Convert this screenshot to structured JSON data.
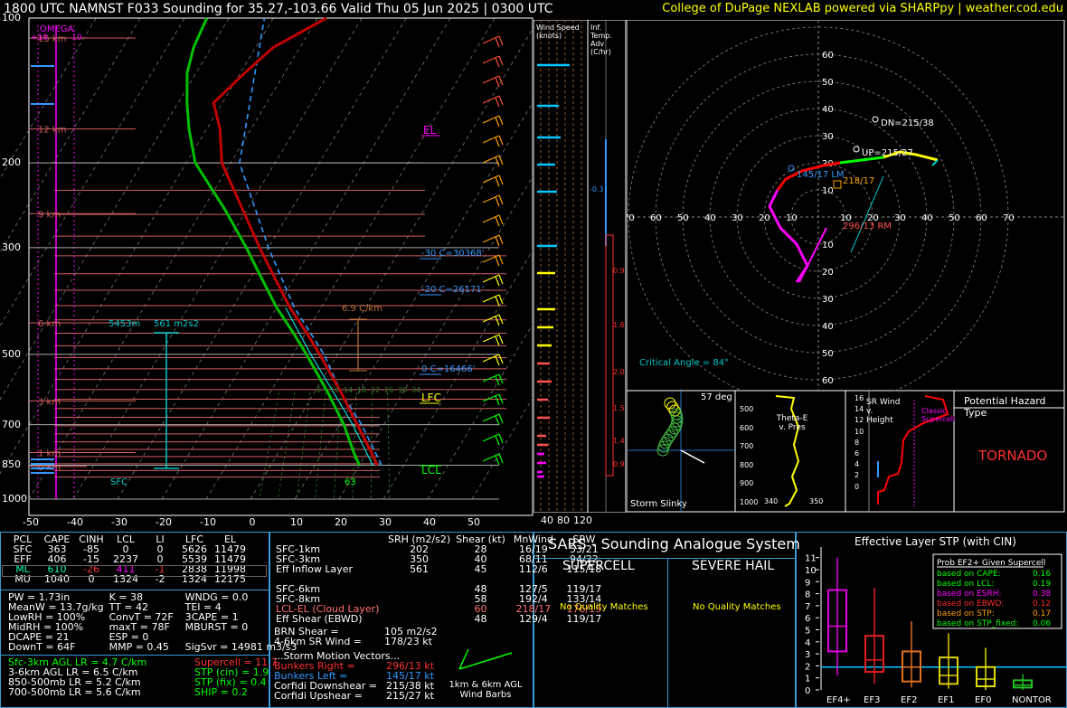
{
  "header": {
    "title": "1800 UTC NAMNST F033 Sounding for 35.27,-103.66 Valid  Thu 05 Jun 2025 | 0300 UTC",
    "credit": "College of DuPage NEXLAB powered via SHARPpy | weather.cod.edu"
  },
  "skewt": {
    "pressure_ticks": [
      "100",
      "200",
      "300",
      "500",
      "700",
      "850",
      "1000"
    ],
    "temp_ticks": [
      "-50",
      "-40",
      "-30",
      "-20",
      "-10",
      "0",
      "10",
      "20",
      "30",
      "40",
      "50"
    ],
    "height_labels": [
      "15 km",
      "12 km",
      "9 km",
      "6 km",
      "3 km",
      "1 km",
      "0 km"
    ],
    "omega_label": "OMEGA",
    "omega_scale": "+10",
    "omega_scale_neg": "-10",
    "el_label": "EL",
    "lfc_label": "LFC",
    "lcl_label": "LCL",
    "sfc_label": "SFC",
    "hgz_labels": [
      "-30 C=30368'",
      "-20 C=26171'",
      "0 C=16466'"
    ],
    "effective_inflow": "5453m",
    "srh_label": "561 m2s2",
    "lapse_label": "6.9 C/km",
    "sfc_temp_label": "63",
    "mixing_ratios": [
      "6",
      "10",
      "14",
      "18",
      "22",
      "26",
      "30",
      "34"
    ],
    "colors": {
      "temp": "#e00000",
      "dew": "#00c000",
      "wetbulb": "#00ffff",
      "virtual": "#3399ff"
    }
  },
  "wind_speed_panel": {
    "title": "Wind Speed (knots)",
    "ticks": [
      "40",
      "80",
      "120"
    ]
  },
  "inferred_adv": {
    "title": "Inf. Temp. Adv (C/hr)",
    "values": [
      "-0.3",
      "0.9",
      "1.6",
      "2.0",
      "1.5",
      "1.4",
      "0.9"
    ]
  },
  "hodograph": {
    "rings": [
      "10",
      "20",
      "30",
      "40",
      "50",
      "60",
      "70"
    ],
    "dn": "DN=215/38",
    "up": "UP=215/27",
    "left_mover": "145/17 LM",
    "mean": "218/17",
    "right_mover": "296/13 RM",
    "critical_angle": "Critical Angle = 84°"
  },
  "storm_slinky": {
    "label": "Storm Slinky",
    "angle": "57 deg"
  },
  "theta_e": {
    "label": "Theta-E v. Pres",
    "y_ticks": [
      "500",
      "600",
      "700",
      "800",
      "900",
      "1000"
    ],
    "x_ticks": [
      "340",
      "350"
    ]
  },
  "sr_wind": {
    "label": "SR Wind v. Height",
    "y_ticks": [
      "16",
      "14",
      "12",
      "10",
      "8",
      "6",
      "4",
      "2",
      "0"
    ],
    "classic": "Classic Supercell"
  },
  "hazard": {
    "title": "Potential Hazard Type",
    "value": "TORNADO"
  },
  "parcels": {
    "headers": [
      "PCL",
      "CAPE",
      "CINH",
      "LCL",
      "LI",
      "LFC",
      "EL"
    ],
    "rows": [
      [
        "SFC",
        "363",
        "-85",
        "0",
        "0",
        "5626",
        "11479"
      ],
      [
        "EFF",
        "406",
        "-15",
        "2237",
        "0",
        "5539",
        "11479"
      ],
      [
        "ML",
        "610",
        "-26",
        "411",
        "-1",
        "2838",
        "11998"
      ],
      [
        "MU",
        "1040",
        "0",
        "1324",
        "-2",
        "1324",
        "12175"
      ]
    ]
  },
  "indices": {
    "col1": [
      "PW = 1.73in",
      "MeanW = 13.7g/kg",
      "LowRH = 100%",
      "MidRH = 100%",
      "DCAPE = 21",
      "DownT = 64F"
    ],
    "col2": [
      "K = 38",
      "TT = 42",
      "ConvT = 72F",
      "maxT = 78F",
      "ESP = 0",
      "MMP = 0.45"
    ],
    "col3": [
      "WNDG = 0.0",
      "TEI = 4",
      "3CAPE = 1",
      "MBURST = 0",
      "",
      "SigSvr = 14981 m3/s3"
    ]
  },
  "lapse": {
    "left": [
      "Sfc-3km AGL LR = 4.7 C/km",
      "3-6km AGL LR = 6.5 C/km",
      "850-500mb LR = 5.2 C/km",
      "700-500mb LR = 5.6 C/km"
    ],
    "right": [
      "Supercell = 11.7",
      "STP (cin) = 1.9",
      "STP (fix) = 0.4",
      "SHIP = 0.2"
    ]
  },
  "kinematics": {
    "headers": [
      "SRH (m2/s2)",
      "Shear (kt)",
      "MnWind",
      "SRW"
    ],
    "rows": [
      [
        "SFC-1km",
        "202",
        "28",
        "16/19",
        "53/21"
      ],
      [
        "SFC-3km",
        "350",
        "40",
        "68/11",
        "94/22"
      ],
      [
        "Eff Inflow Layer",
        "561",
        "45",
        "112/6",
        "115/18"
      ],
      [
        "",
        "",
        "",
        "",
        ""
      ],
      [
        "SFC-6km",
        "",
        "48",
        "127/5",
        "119/17"
      ],
      [
        "SFC-8km",
        "",
        "58",
        "192/4",
        "133/14"
      ],
      [
        "LCL-EL (Cloud Layer)",
        "",
        "60",
        "218/17",
        "176/19"
      ],
      [
        "Eff Shear (EBWD)",
        "",
        "48",
        "129/4",
        "119/17"
      ]
    ],
    "brn": "BRN Shear =",
    "brn_val": "105 m2/s2",
    "sr46": "4-6km SR Wind =",
    "sr46_val": "178/23 kt",
    "sm_title": "...Storm Motion Vectors...",
    "sm": [
      [
        "Bunkers Right =",
        "296/13 kt"
      ],
      [
        "Bunkers Left =",
        "145/17 kt"
      ],
      [
        "Corfidi Downshear =",
        "215/38 kt"
      ],
      [
        "Corfidi Upshear =",
        "215/27 kt"
      ]
    ],
    "barbs_label": "1km & 6km AGL Wind Barbs"
  },
  "sars": {
    "title": "SARS - Sounding Analogue System",
    "supercell": "SUPERCELL",
    "hail": "SEVERE HAIL",
    "sc_match": "No Quality Matches",
    "hail_match": "No Quality Matches"
  },
  "stp": {
    "title": "Effective Layer STP (with CIN)",
    "legend_title": "Prob EF2+ Given Supercell",
    "legend": [
      [
        "based on CAPE:",
        "0.16"
      ],
      [
        "based on LCL:",
        "0.19"
      ],
      [
        "based on ESRH:",
        "0.38"
      ],
      [
        "based on EBWD:",
        "0.12"
      ],
      [
        "based on STP:",
        "0.17"
      ],
      [
        "based on STP_fixed:",
        "0.06"
      ]
    ],
    "y_ticks": [
      "0",
      "1",
      "2",
      "3",
      "4",
      "5",
      "6",
      "7",
      "8",
      "9",
      "10",
      "11"
    ],
    "categories": [
      "EF4+",
      "EF3",
      "EF2",
      "EF1",
      "EF0",
      "NONTOR"
    ],
    "current": 1.9
  },
  "chart_data": [
    {
      "type": "line",
      "title": "1800 UTC NAMNST F033 Sounding for 35.27,-103.66 Valid  Thu 05 Jun 2025 | 0300 UTC",
      "xlabel": "",
      "ylabel": "",
      "ylim": [
        1000,
        100
      ],
      "xlim": [
        -50,
        50
      ],
      "series": [
        {
          "name": "",
          "x_units": "C",
          "points": [
            [
              1000,
              null
            ],
            [
              850,
              24
            ],
            [
              800,
              20
            ],
            [
              700,
              13
            ],
            [
              600,
              5
            ],
            [
              500,
              -5
            ],
            [
              400,
              -17
            ],
            [
              300,
              -32
            ],
            [
              250,
              -40
            ],
            [
              200,
              -50
            ],
            [
              150,
              -58
            ],
            [
              120,
              -62
            ],
            [
              100,
              -58
            ]
          ]
        },
        {
          "name": "",
          "x_units": "C",
          "points": [
            [
              850,
              19
            ],
            [
              800,
              17
            ],
            [
              700,
              12
            ],
            [
              600,
              4
            ],
            [
              500,
              -7
            ],
            [
              400,
              -19
            ],
            [
              300,
              -34
            ],
            [
              250,
              -43
            ],
            [
              200,
              -55
            ],
            [
              150,
              -66
            ],
            [
              100,
              -80
            ]
          ]
        }
      ]
    },
    {
      "type": "bar",
      "title": "Effective Layer STP (with CIN)",
      "categories": [
        "EF4+",
        "EF3",
        "EF2",
        "EF1",
        "EF0",
        "NONTOR"
      ],
      "series": [
        {
          "name": "",
          "values": [
            [
              1.2,
              3.2,
              5.3,
              8.3,
              11.0
            ],
            [
              0.5,
              1.5,
              2.5,
              4.5,
              8.5
            ],
            [
              0.2,
              0.7,
              1.9,
              3.2,
              5.7
            ],
            [
              0.1,
              0.5,
              1.2,
              2.7,
              4.7
            ],
            [
              0.0,
              0.3,
              0.9,
              1.9,
              3.5
            ],
            [
              0.0,
              0.2,
              0.4,
              0.8,
              1.3
            ]
          ]
        }
      ],
      "ylim": [
        0,
        11
      ],
      "reference_line": 1.9
    }
  ]
}
